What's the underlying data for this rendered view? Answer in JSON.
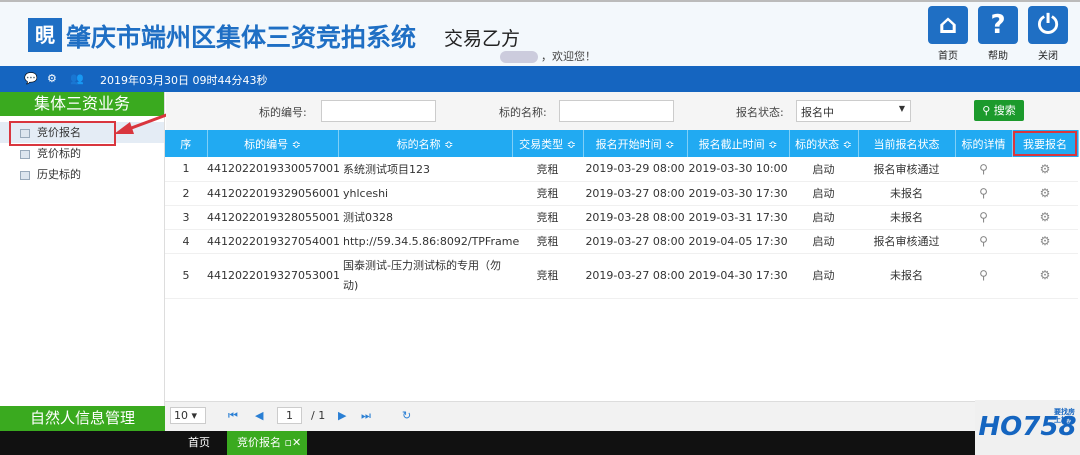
{
  "header": {
    "logo": "晛",
    "title": "肇庆市端州区集体三资竞拍系统",
    "subtitle": "交易乙方",
    "welcome": "，欢迎您！",
    "buttons": [
      {
        "label": "首页",
        "icon": "home-icon"
      },
      {
        "label": "帮助",
        "icon": "help-icon"
      },
      {
        "label": "关闭",
        "icon": "power-icon"
      }
    ]
  },
  "statusbar": {
    "datetime": "2019年03月30日 09时44分43秒"
  },
  "sidebar": {
    "section": "集体三资业务",
    "items": [
      {
        "label": "竞价报名"
      },
      {
        "label": "竞价标的"
      },
      {
        "label": "历史标的"
      }
    ],
    "section2": "自然人信息管理"
  },
  "filter": {
    "code_label": "标的编号:",
    "code_value": "",
    "name_label": "标的名称:",
    "name_value": "",
    "status_label": "报名状态:",
    "status_value": "报名中",
    "search": "搜索"
  },
  "table": {
    "headers": [
      "序",
      "标的编号 ≎",
      "标的名称 ≎",
      "交易类型 ≎",
      "报名开始时间 ≎",
      "报名截止时间 ≎",
      "标的状态 ≎",
      "当前报名状态",
      "标的详情",
      "我要报名"
    ],
    "rows": [
      [
        "1",
        "4412022019330057001",
        "系统测试项目123",
        "竞租",
        "2019-03-29 08:00",
        "2019-03-30 10:00",
        "启动",
        "报名审核通过"
      ],
      [
        "2",
        "4412022019329056001",
        "yhlceshi",
        "竞租",
        "2019-03-27 08:00",
        "2019-03-30 17:30",
        "启动",
        "未报名"
      ],
      [
        "3",
        "4412022019328055001",
        "测试0328",
        "竞租",
        "2019-03-28 08:00",
        "2019-03-31 17:30",
        "启动",
        "未报名"
      ],
      [
        "4",
        "4412022019327054001",
        "http://59.34.5.86:8092/TPFrame",
        "竞租",
        "2019-03-27 08:00",
        "2019-04-05 17:30",
        "启动",
        "报名审核通过"
      ],
      [
        "5",
        "4412022019327053001",
        "国泰测试-压力测试标的专用（勿动)",
        "竞租",
        "2019-03-27 08:00",
        "2019-04-30 17:30",
        "启动",
        "未报名"
      ]
    ]
  },
  "pager": {
    "page_size": "10",
    "page": "1",
    "total": "/ 1"
  },
  "tabs": {
    "home": "首页",
    "active": "竞价报名"
  },
  "watermark": {
    "text": "HO758",
    "tagline": "要找房 上雄房"
  }
}
